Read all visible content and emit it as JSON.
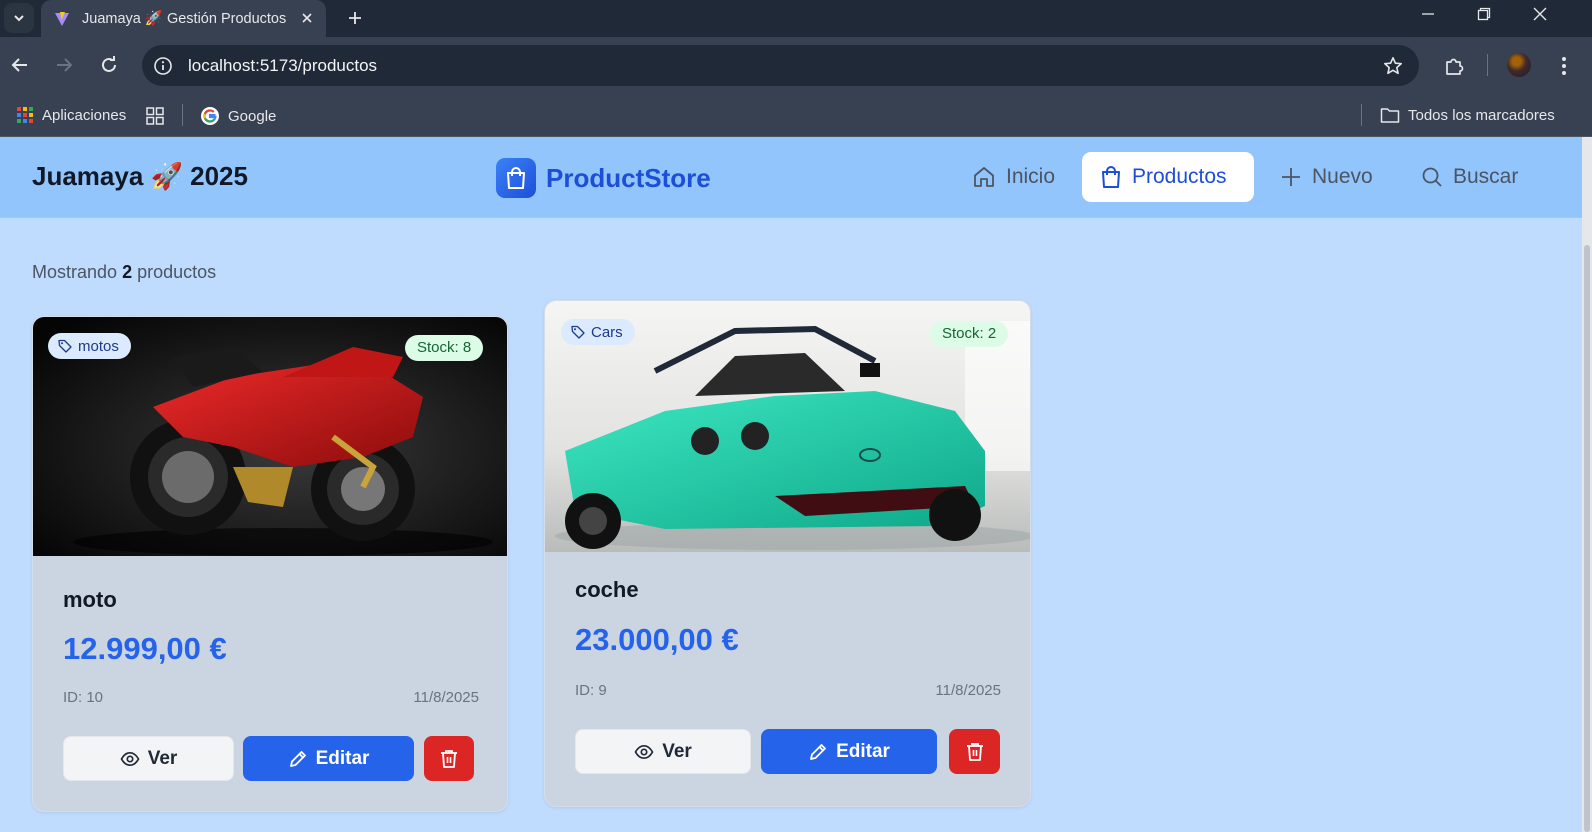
{
  "browser": {
    "tab_title": "Juamaya 🚀 Gestión Productos",
    "url_host": "localhost",
    "url_rest": ":5173/productos",
    "bookmarks": {
      "apps_label": "Aplicaciones",
      "google_label": "Google",
      "all_bookmarks_label": "Todos los marcadores"
    }
  },
  "header": {
    "brand": "Juamaya 🚀 2025",
    "logo_text": "ProductStore",
    "nav": {
      "home": "Inicio",
      "products": "Productos",
      "new": "Nuevo",
      "search": "Buscar"
    }
  },
  "content": {
    "count_prefix": "Mostrando",
    "count_value": "2",
    "count_suffix": "productos"
  },
  "products": [
    {
      "category": "motos",
      "stock": "Stock: 8",
      "name": "moto",
      "price": "12.999,00 €",
      "id": "ID: 10",
      "date": "11/8/2025",
      "image_desc": "red sport motorcycle"
    },
    {
      "category": "Cars",
      "stock": "Stock: 2",
      "name": "coche",
      "price": "23.000,00 €",
      "id": "ID: 9",
      "date": "11/8/2025",
      "image_desc": "turquoise open sports car"
    }
  ],
  "buttons": {
    "view": "Ver",
    "edit": "Editar"
  },
  "colors": {
    "page_bg": "#bfdbfe",
    "header_bg": "#93c5fd",
    "accent": "#2563eb",
    "danger": "#dc2626",
    "card_bg": "#cbd5e1"
  }
}
